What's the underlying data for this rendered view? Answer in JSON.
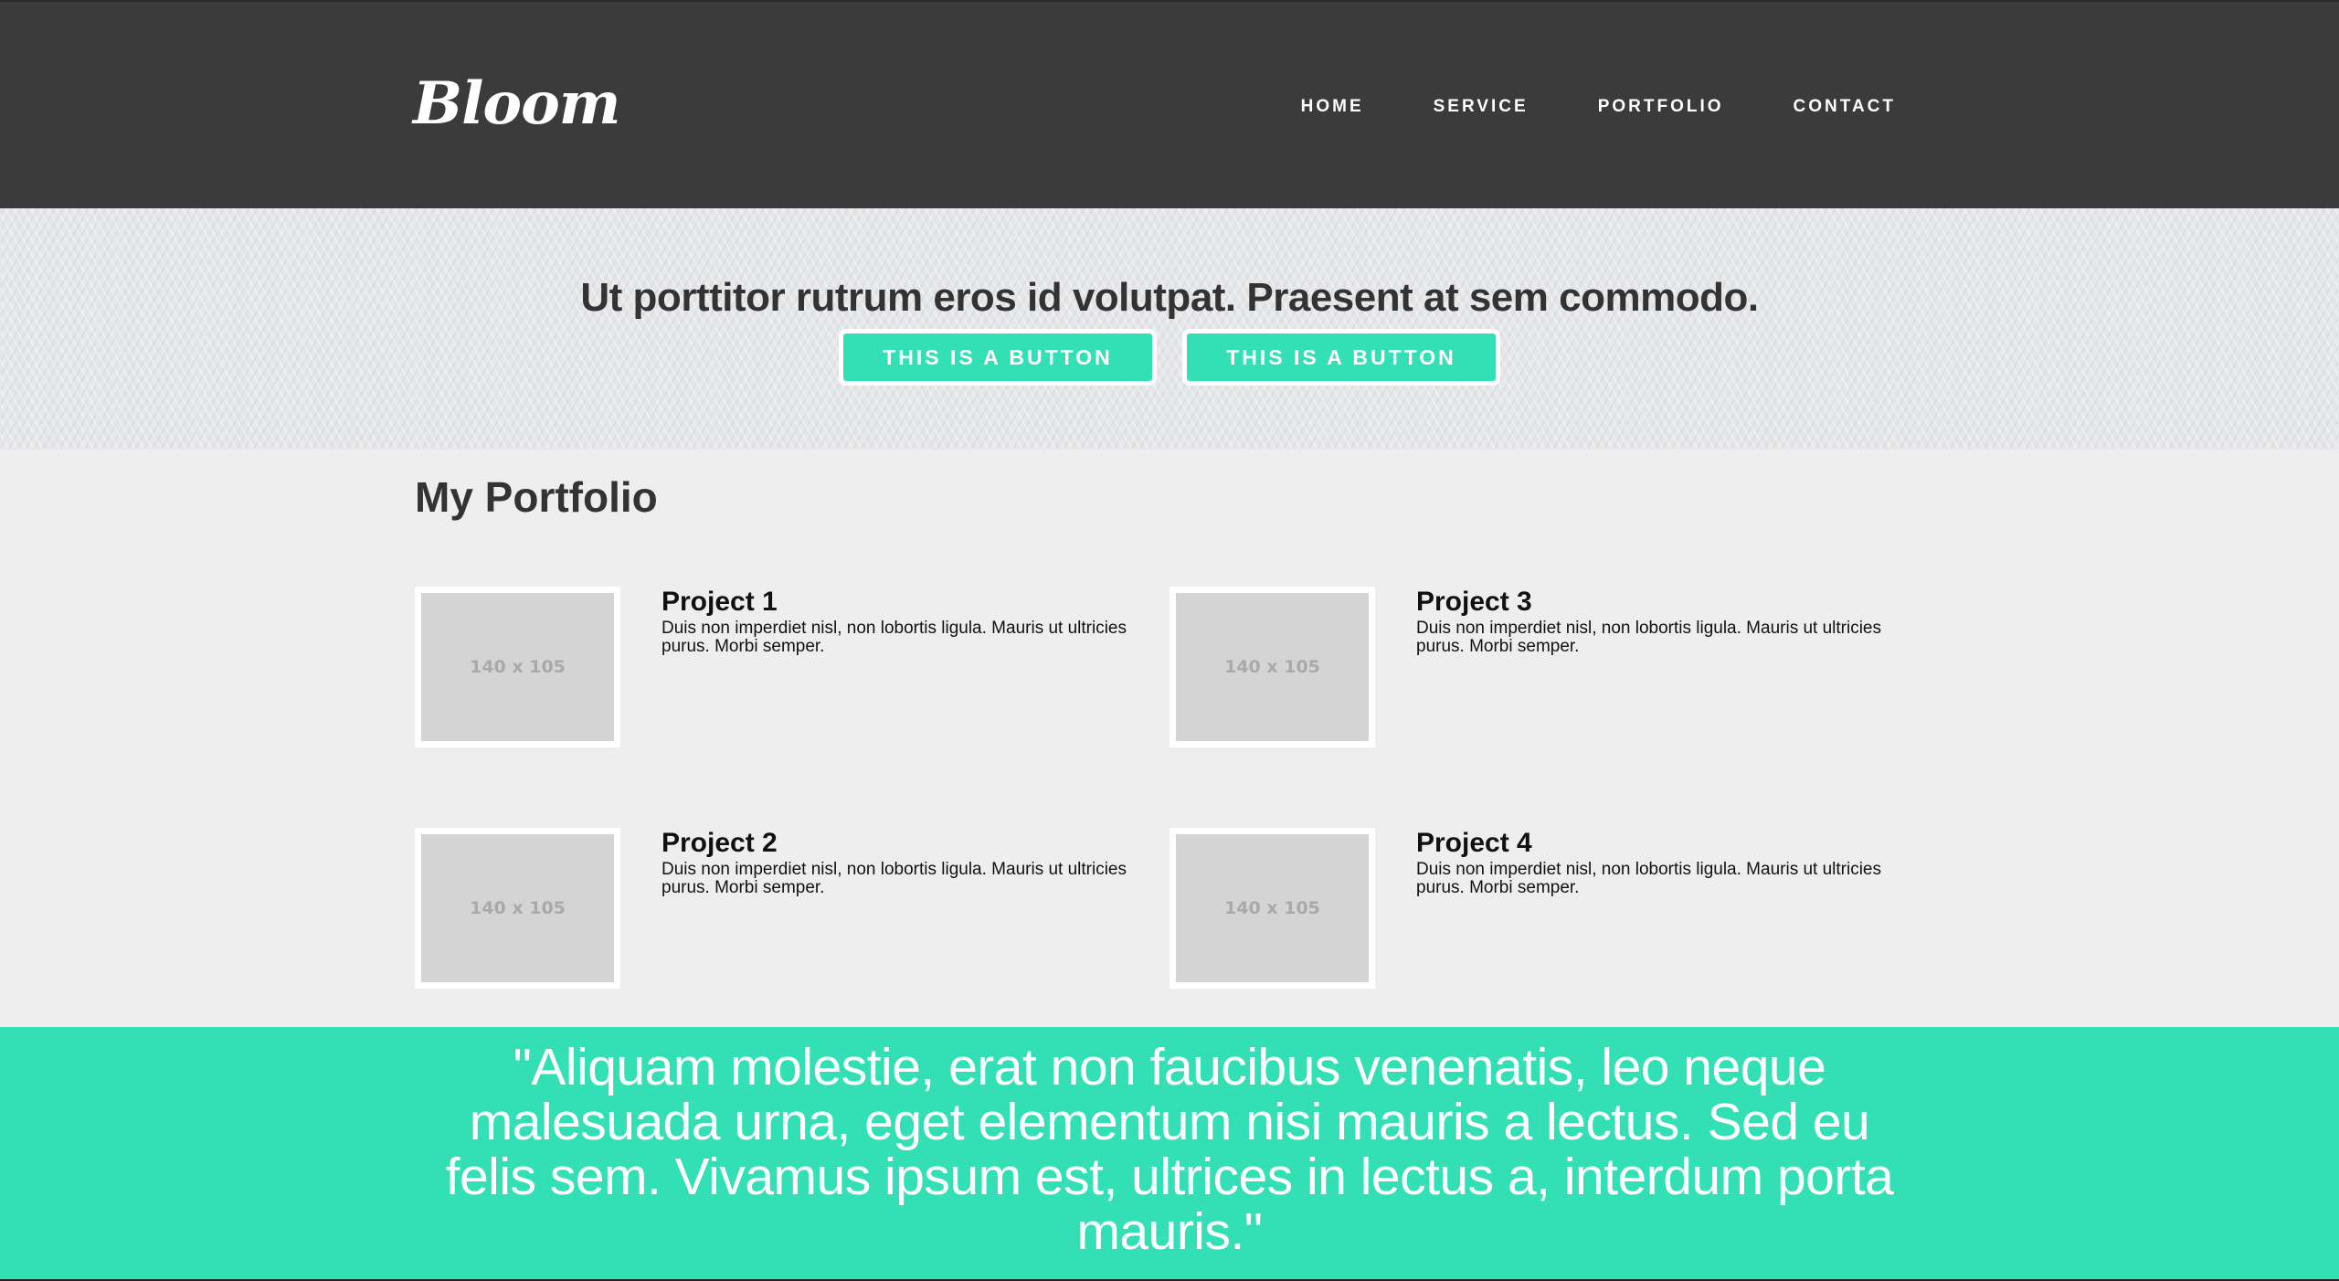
{
  "header": {
    "logo": "Bloom",
    "nav": [
      "HOME",
      "SERVICE",
      "PORTFOLIO",
      "CONTACT"
    ]
  },
  "hero": {
    "headline": "Ut porttitor rutrum eros id volutpat. Praesent at sem commodo.",
    "buttons": [
      "THIS IS A BUTTON",
      "THIS IS A BUTTON"
    ]
  },
  "portfolio": {
    "title": "My Portfolio",
    "projects": [
      {
        "title": "Project 1",
        "description": "Duis non imperdiet nisl, non lobortis ligula. Mauris ut ultricies purus. Morbi semper.",
        "thumb_label": "140 x 105"
      },
      {
        "title": "Project 3",
        "description": "Duis non imperdiet nisl, non lobortis ligula. Mauris ut ultricies purus. Morbi semper.",
        "thumb_label": "140 x 105"
      },
      {
        "title": "Project 2",
        "description": "Duis non imperdiet nisl, non lobortis ligula. Mauris ut ultricies purus. Morbi semper.",
        "thumb_label": "140 x 105"
      },
      {
        "title": "Project 4",
        "description": "Duis non imperdiet nisl, non lobortis ligula. Mauris ut ultricies purus. Morbi semper.",
        "thumb_label": "140 x 105"
      }
    ]
  },
  "quote": {
    "text": "\"Aliquam molestie, erat non faucibus venenatis, leo neque malesuada urna, eget elementum nisi mauris a lectus. Sed eu felis sem. Vivamus ipsum est, ultrices in lectus a, interdum porta mauris.\""
  },
  "colors": {
    "header_bg": "#3b3b3b",
    "accent": "#33e0b5",
    "page_bg": "#eeeeee",
    "hero_bg": "#e6e7e9"
  }
}
